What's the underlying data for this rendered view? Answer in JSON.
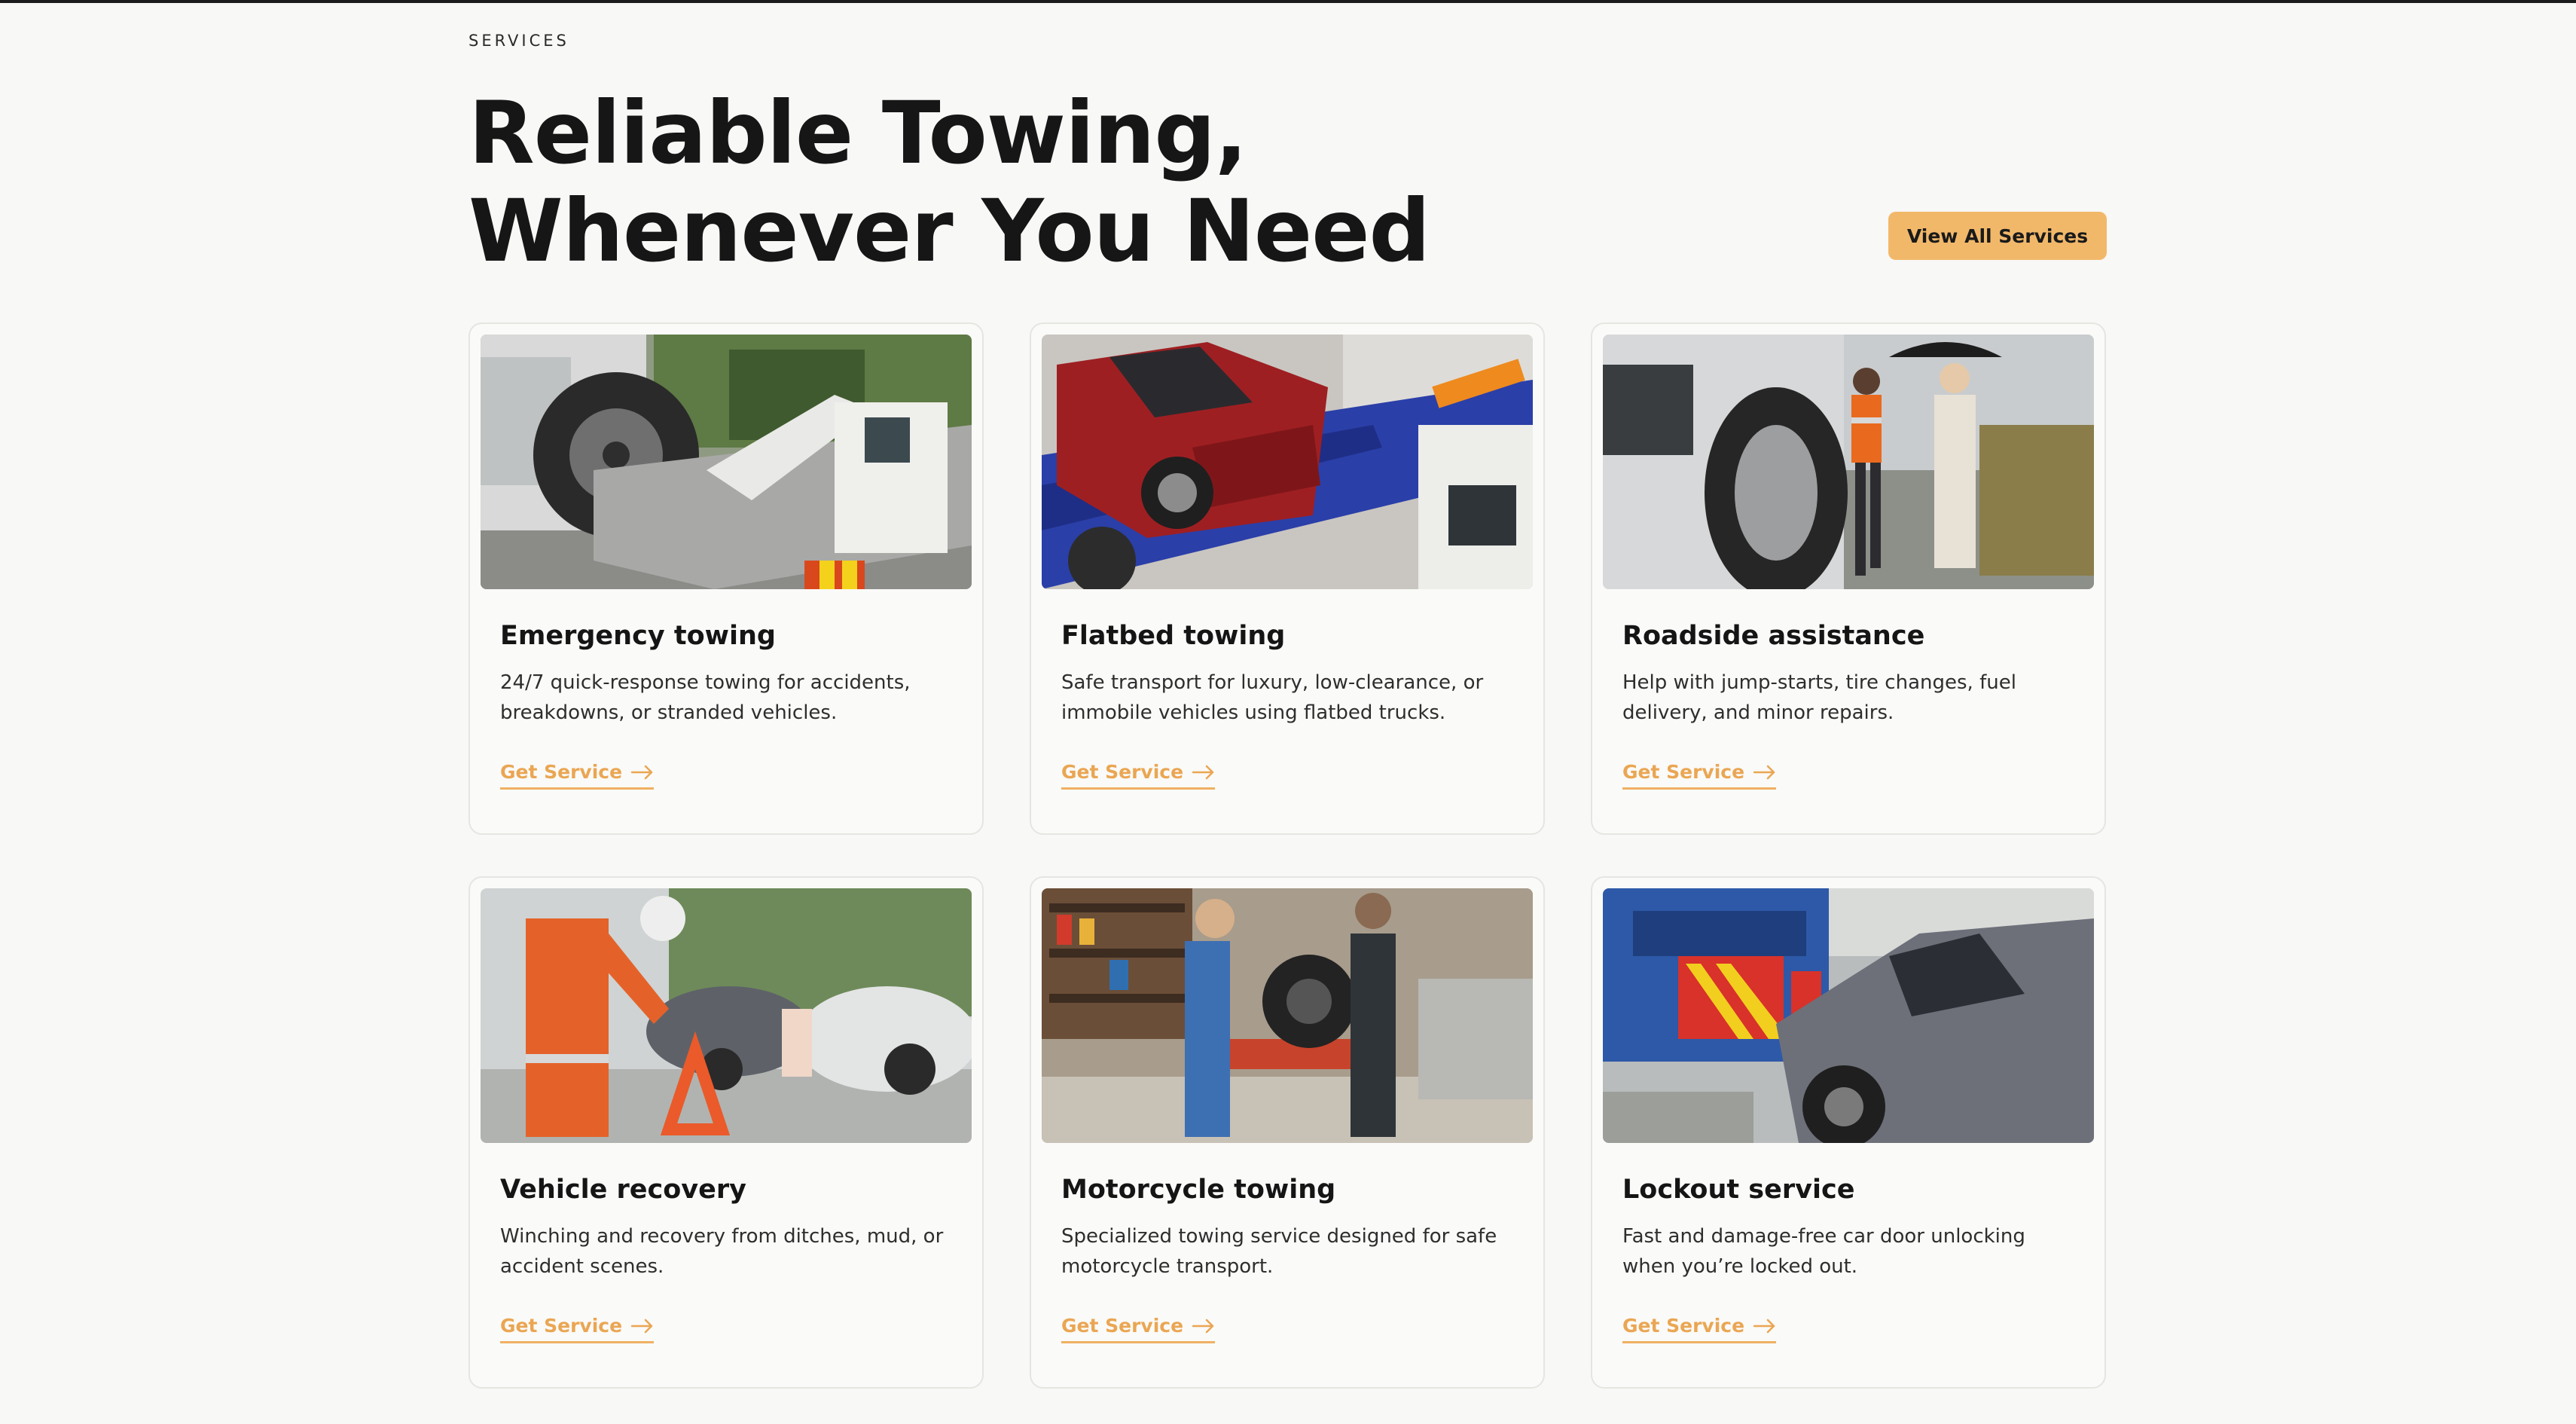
{
  "header": {
    "eyebrow": "SERVICES",
    "headline_line1": "Reliable Towing,",
    "headline_line2": "Whenever You Need",
    "view_all_label": "View All Services"
  },
  "colors": {
    "background": "#f8f8f6",
    "accent": "#f2b86a",
    "link": "#eaa653",
    "text": "#161616"
  },
  "cards": [
    {
      "title": "Emergency towing",
      "description": "24/7 quick-response towing for accidents, breakdowns, or stranded vehicles.",
      "cta": "Get Service",
      "image": "tow-truck-loading-car-photo"
    },
    {
      "title": "Flatbed towing",
      "description": "Safe transport for luxury, low-clearance, or immobile vehicles using flatbed trucks.",
      "cta": "Get Service",
      "image": "red-car-on-flatbed-photo"
    },
    {
      "title": "Roadside assistance",
      "description": "Help with jump-starts, tire changes, fuel delivery, and minor repairs.",
      "cta": "Get Service",
      "image": "mechanic-changing-tire-photo"
    },
    {
      "title": "Vehicle recovery",
      "description": "Winching and recovery from ditches, mud, or accident scenes.",
      "cta": "Get Service",
      "image": "warning-triangle-accident-photo"
    },
    {
      "title": "Motorcycle towing",
      "description": "Specialized towing service designed for safe motorcycle transport.",
      "cta": "Get Service",
      "image": "motorcycle-workshop-photo"
    },
    {
      "title": "Lockout service",
      "description": "Fast and damage-free car door unlocking when you’re locked out.",
      "cta": "Get Service",
      "image": "tow-truck-with-grey-car-photo"
    }
  ]
}
